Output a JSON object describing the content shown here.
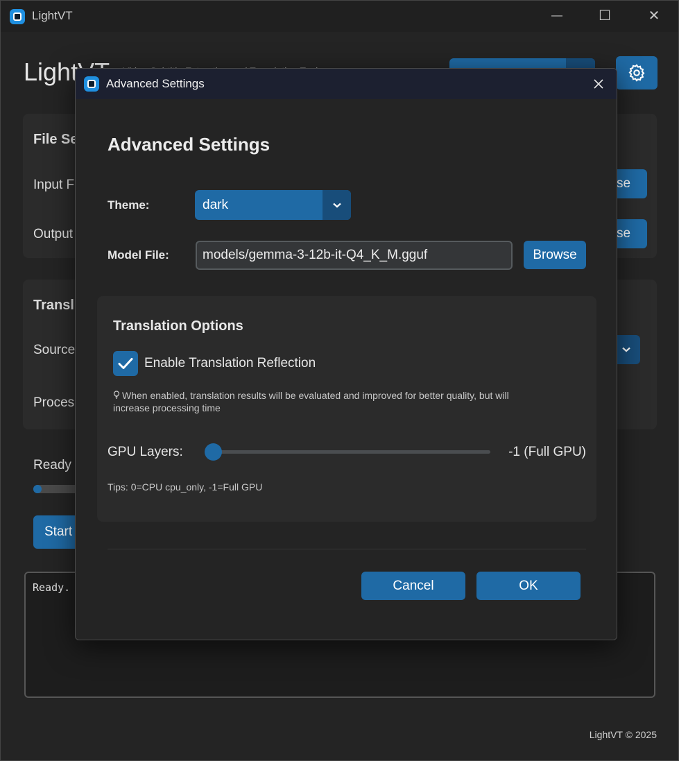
{
  "main_window": {
    "title": "LightVT",
    "heading": "LightVT",
    "subtitle": "Video Subtitle Extraction and Translation Tool",
    "minimize_glyph": "—",
    "maximize_glyph": "☐",
    "close_glyph": "✕",
    "file_section_title": "File Se",
    "input_label": "Input F",
    "output_label": "Output",
    "browse_partial_1": "se",
    "browse_partial_2": "se",
    "translation_section_title": "Transl",
    "source_label": "Source",
    "process_label": "Proces",
    "status_text": "Ready",
    "start_button_label": "Start",
    "log_text": "Ready.",
    "footer": "LightVT © 2025",
    "progress": 0
  },
  "dialog": {
    "title": "Advanced Settings",
    "heading": "Advanced Settings",
    "close_glyph": "✕",
    "theme_label": "Theme:",
    "theme_value": "dark",
    "model_label": "Model File:",
    "model_value": "models/gemma-3-12b-it-Q4_K_M.gguf",
    "browse_label": "Browse",
    "options_title": "Translation Options",
    "reflection_checked": true,
    "reflection_label": "Enable Translation Reflection",
    "reflection_hint": "When enabled, translation results will be evaluated and improved for better quality, but will increase processing time",
    "gpu_label": "GPU Layers:",
    "gpu_value": "-1 (Full GPU)",
    "gpu_slider_fraction": 0,
    "tips": "Tips: 0=CPU cpu_only, -1=Full GPU",
    "cancel_label": "Cancel",
    "ok_label": "OK"
  },
  "icons": {
    "app": "app-logo-icon",
    "settings": "gear-icon",
    "dropdown": "chevron-down-icon",
    "check": "check-icon",
    "hint": "lightbulb-icon",
    "close": "close-icon"
  },
  "colors": {
    "accent": "#1f6aa5",
    "accent_dark": "#184d7a",
    "background": "#242424",
    "panel": "#2b2b2b"
  }
}
